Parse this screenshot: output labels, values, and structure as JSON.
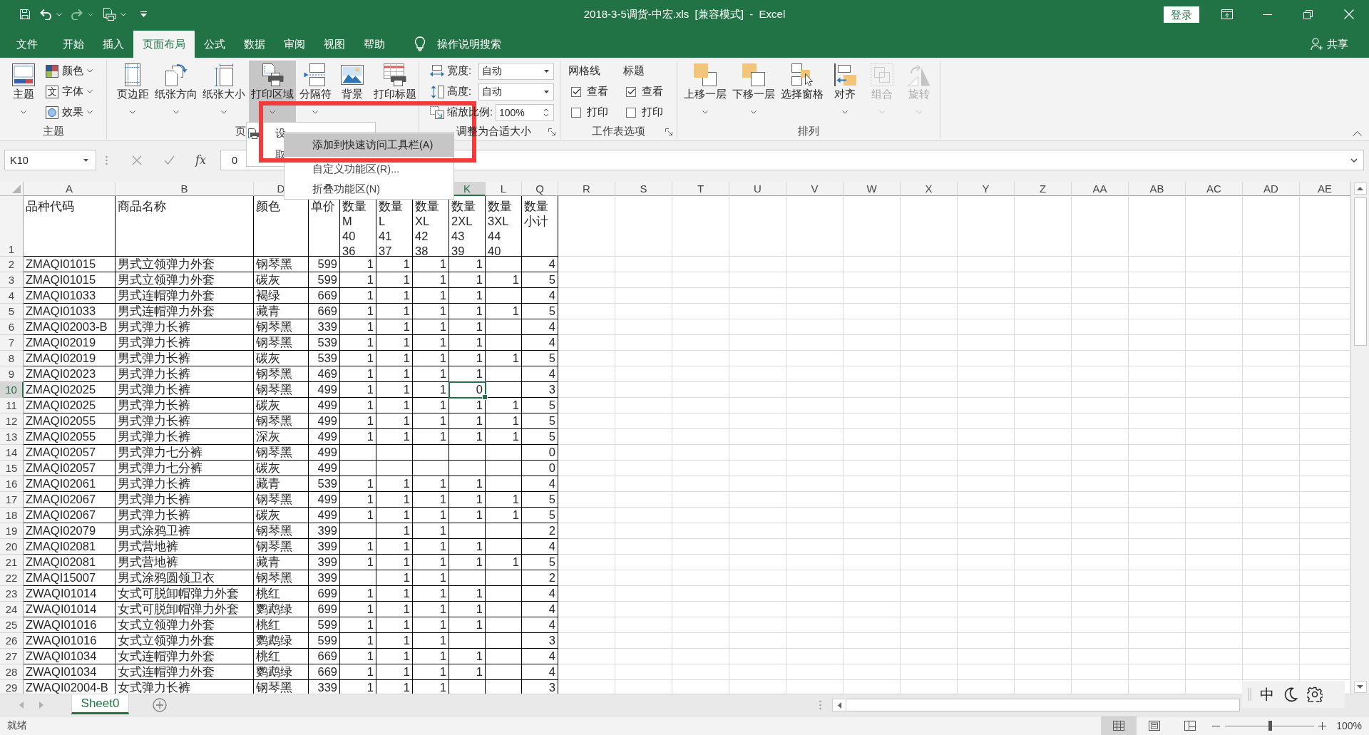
{
  "title_bar": {
    "quick_access": [
      {
        "kind": "save",
        "dropdown": false,
        "disabled": false
      },
      {
        "kind": "undo",
        "dropdown": true,
        "disabled": false
      },
      {
        "kind": "redo",
        "dropdown": true,
        "disabled": true
      },
      {
        "kind": "print_preview",
        "dropdown": true,
        "disabled": false
      }
    ],
    "title": "2018-3-5调货-中宏.xls  [兼容模式]  -  Excel",
    "sign_in": "登录"
  },
  "tabs": [
    {
      "label": "文件",
      "selected": false
    },
    {
      "label": "开始",
      "selected": false
    },
    {
      "label": "插入",
      "selected": false
    },
    {
      "label": "页面布局",
      "selected": true
    },
    {
      "label": "公式",
      "selected": false
    },
    {
      "label": "数据",
      "selected": false
    },
    {
      "label": "审阅",
      "selected": false
    },
    {
      "label": "视图",
      "selected": false
    },
    {
      "label": "帮助",
      "selected": false
    }
  ],
  "tell_me": "操作说明搜索",
  "share": "共享",
  "ribbon": {
    "groups": [
      {
        "kind": "theme",
        "label": "主题",
        "large": {
          "label": "主题",
          "dropdown": true
        },
        "small": [
          {
            "kind": "colors",
            "label": "颜色"
          },
          {
            "kind": "fonts",
            "label": "字体",
            "glyph": "文"
          },
          {
            "kind": "effects",
            "label": "效果"
          }
        ]
      },
      {
        "kind": "buttons",
        "label": "页",
        "buttons": [
          {
            "kind": "margins",
            "label": "页边距",
            "dropdown": true,
            "pressed": false
          },
          {
            "kind": "orientation",
            "label": "纸张方向",
            "dropdown": true,
            "pressed": false
          },
          {
            "kind": "size",
            "label": "纸张大小",
            "dropdown": true,
            "pressed": false
          },
          {
            "kind": "print_area",
            "label": "打印区域",
            "dropdown": true,
            "pressed": true
          },
          {
            "kind": "breaks",
            "label": "分隔符",
            "dropdown": true,
            "pressed": false
          },
          {
            "kind": "background",
            "label": "背景",
            "dropdown": false,
            "pressed": false
          },
          {
            "kind": "print_titles",
            "label": "打印标题",
            "dropdown": false,
            "pressed": false
          }
        ]
      },
      {
        "kind": "scale",
        "label": "调整为合适大小",
        "launcher": true,
        "rows": [
          {
            "kind": "combo",
            "label": "宽度:",
            "value": "自动"
          },
          {
            "kind": "combo",
            "label": "高度:",
            "value": "自动"
          },
          {
            "kind": "spin",
            "label": "缩放比例:",
            "value": "100%"
          }
        ]
      },
      {
        "kind": "sheet_options",
        "label": "工作表选项",
        "launcher": true,
        "columns": [
          {
            "heading": "网格线",
            "options": [
              {
                "label": "查看",
                "checked": true
              },
              {
                "label": "打印",
                "checked": false
              }
            ]
          },
          {
            "heading": "标题",
            "options": [
              {
                "label": "查看",
                "checked": true
              },
              {
                "label": "打印",
                "checked": false
              }
            ]
          }
        ]
      },
      {
        "kind": "buttons",
        "label": "排列",
        "launcher": false,
        "buttons": [
          {
            "kind": "bring_forward",
            "label": "上移一层",
            "dropdown": true,
            "disabled": false
          },
          {
            "kind": "send_backward",
            "label": "下移一层",
            "dropdown": true,
            "disabled": false
          },
          {
            "kind": "selection_pane",
            "label": "选择窗格",
            "dropdown": false,
            "disabled": false
          },
          {
            "kind": "align",
            "label": "对齐",
            "dropdown": true,
            "disabled": false
          },
          {
            "kind": "group",
            "label": "组合",
            "dropdown": true,
            "disabled": true
          },
          {
            "kind": "rotate",
            "label": "旋转",
            "dropdown": true,
            "disabled": true
          }
        ]
      }
    ]
  },
  "formula_bar": {
    "name_box": "K10",
    "function_label": "fx",
    "formula": "0"
  },
  "print_area_menu": {
    "items": [
      {
        "label": "设"
      },
      {
        "label": "取"
      }
    ]
  },
  "context_menu": {
    "items": [
      {
        "label": "添加到快速访问工具栏(A)",
        "selected": true
      },
      {
        "label": "自定义功能区(R)...",
        "selected": false
      },
      {
        "label": "折叠功能区(N)",
        "selected": false
      }
    ]
  },
  "annotation": {
    "kind": "frame"
  },
  "sheet": {
    "columns": [
      {
        "letter": "A",
        "selected": false
      },
      {
        "letter": "B",
        "selected": false
      },
      {
        "letter": "D",
        "selected": false
      },
      {},
      {},
      {},
      {},
      {
        "letter": "K",
        "selected": true
      },
      {
        "letter": "L",
        "selected": false
      },
      {
        "letter": "Q",
        "selected": false
      },
      {
        "letter": "R",
        "selected": false
      },
      {
        "letter": "S",
        "selected": false
      },
      {
        "letter": "T",
        "selected": false
      },
      {
        "letter": "U",
        "selected": false
      },
      {
        "letter": "V",
        "selected": false
      },
      {
        "letter": "W",
        "selected": false
      },
      {
        "letter": "X",
        "selected": false
      },
      {
        "letter": "Y",
        "selected": false
      },
      {
        "letter": "Z",
        "selected": false
      },
      {
        "letter": "AA",
        "selected": false
      },
      {
        "letter": "AB",
        "selected": false
      },
      {
        "letter": "AC",
        "selected": false
      },
      {
        "letter": "AD",
        "selected": false
      },
      {
        "letter": "AE",
        "selected": false
      }
    ],
    "rows": [
      {
        "number": "1",
        "kind": "header",
        "selected": false,
        "cells": [
          "品种代码",
          "商品名称",
          "颜色",
          "单价",
          "数量\nM\n40\n36",
          "数量\nL\n41\n37",
          "数量\nXL\n42\n38",
          "数量\n2XL\n43\n39",
          "数量\n3XL\n44\n40",
          "数量小计"
        ]
      },
      {
        "number": "2",
        "kind": "data",
        "selected": false,
        "cells": [
          "ZMAQI01015",
          "男式立领弹力外套",
          "钢琴黑",
          "599",
          "1",
          "1",
          "1",
          "1",
          null,
          "4"
        ]
      },
      {
        "number": "3",
        "kind": "data",
        "selected": false,
        "cells": [
          "ZMAQI01015",
          "男式立领弹力外套",
          "碳灰",
          "599",
          "1",
          "1",
          "1",
          "1",
          "1",
          "5"
        ]
      },
      {
        "number": "4",
        "kind": "data",
        "selected": false,
        "cells": [
          "ZMAQI01033",
          "男式连帽弹力外套",
          "褐绿",
          "669",
          "1",
          "1",
          "1",
          "1",
          null,
          "4"
        ]
      },
      {
        "number": "5",
        "kind": "data",
        "selected": false,
        "cells": [
          "ZMAQI01033",
          "男式连帽弹力外套",
          "藏青",
          "669",
          "1",
          "1",
          "1",
          "1",
          "1",
          "5"
        ]
      },
      {
        "number": "6",
        "kind": "data",
        "selected": false,
        "cells": [
          "ZMAQI02003-B",
          "男式弹力长裤",
          "钢琴黑",
          "339",
          "1",
          "1",
          "1",
          "1",
          null,
          "4"
        ]
      },
      {
        "number": "7",
        "kind": "data",
        "selected": false,
        "cells": [
          "ZMAQI02019",
          "男式弹力长裤",
          "钢琴黑",
          "539",
          "1",
          "1",
          "1",
          "1",
          null,
          "4"
        ]
      },
      {
        "number": "8",
        "kind": "data",
        "selected": false,
        "cells": [
          "ZMAQI02019",
          "男式弹力长裤",
          "碳灰",
          "539",
          "1",
          "1",
          "1",
          "1",
          "1",
          "5"
        ]
      },
      {
        "number": "9",
        "kind": "data",
        "selected": false,
        "cells": [
          "ZMAQI02023",
          "男式弹力长裤",
          "钢琴黑",
          "469",
          "1",
          "1",
          "1",
          "1",
          null,
          "4"
        ]
      },
      {
        "number": "10",
        "kind": "data",
        "selected": true,
        "cells": [
          "ZMAQI02025",
          "男式弹力长裤",
          "钢琴黑",
          "499",
          "1",
          "1",
          "1",
          "0",
          null,
          "3"
        ]
      },
      {
        "number": "11",
        "kind": "data",
        "selected": false,
        "cells": [
          "ZMAQI02025",
          "男式弹力长裤",
          "碳灰",
          "499",
          "1",
          "1",
          "1",
          "1",
          "1",
          "5"
        ]
      },
      {
        "number": "12",
        "kind": "data",
        "selected": false,
        "cells": [
          "ZMAQI02055",
          "男式弹力长裤",
          "钢琴黑",
          "499",
          "1",
          "1",
          "1",
          "1",
          "1",
          "5"
        ]
      },
      {
        "number": "13",
        "kind": "data",
        "selected": false,
        "cells": [
          "ZMAQI02055",
          "男式弹力长裤",
          "深灰",
          "499",
          "1",
          "1",
          "1",
          "1",
          "1",
          "5"
        ]
      },
      {
        "number": "14",
        "kind": "data",
        "selected": false,
        "cells": [
          "ZMAQI02057",
          "男式弹力七分裤",
          "钢琴黑",
          "499",
          null,
          null,
          null,
          null,
          null,
          "0"
        ]
      },
      {
        "number": "15",
        "kind": "data",
        "selected": false,
        "cells": [
          "ZMAQI02057",
          "男式弹力七分裤",
          "碳灰",
          "499",
          null,
          null,
          null,
          null,
          null,
          "0"
        ]
      },
      {
        "number": "16",
        "kind": "data",
        "selected": false,
        "cells": [
          "ZMAQI02061",
          "男式弹力长裤",
          "藏青",
          "539",
          "1",
          "1",
          "1",
          "1",
          null,
          "4"
        ]
      },
      {
        "number": "17",
        "kind": "data",
        "selected": false,
        "cells": [
          "ZMAQI02067",
          "男式弹力长裤",
          "钢琴黑",
          "499",
          "1",
          "1",
          "1",
          "1",
          "1",
          "5"
        ]
      },
      {
        "number": "18",
        "kind": "data",
        "selected": false,
        "cells": [
          "ZMAQI02067",
          "男式弹力长裤",
          "碳灰",
          "499",
          "1",
          "1",
          "1",
          "1",
          "1",
          "5"
        ]
      },
      {
        "number": "19",
        "kind": "data",
        "selected": false,
        "cells": [
          "ZMAQI02079",
          "男式涂鸦卫裤",
          "钢琴黑",
          "399",
          null,
          "1",
          "1",
          null,
          null,
          "2"
        ]
      },
      {
        "number": "20",
        "kind": "data",
        "selected": false,
        "cells": [
          "ZMAQI02081",
          "男式营地裤",
          "钢琴黑",
          "399",
          "1",
          "1",
          "1",
          "1",
          null,
          "4"
        ]
      },
      {
        "number": "21",
        "kind": "data",
        "selected": false,
        "cells": [
          "ZMAQI02081",
          "男式营地裤",
          "藏青",
          "399",
          "1",
          "1",
          "1",
          "1",
          "1",
          "5"
        ]
      },
      {
        "number": "22",
        "kind": "data",
        "selected": false,
        "cells": [
          "ZMAQI15007",
          "男式涂鸦圆领卫衣",
          "钢琴黑",
          "399",
          null,
          "1",
          "1",
          null,
          null,
          "2"
        ]
      },
      {
        "number": "23",
        "kind": "data",
        "selected": false,
        "cells": [
          "ZWAQI01014",
          "女式可脱卸帽弹力外套",
          "桃红",
          "699",
          "1",
          "1",
          "1",
          "1",
          null,
          "4"
        ]
      },
      {
        "number": "24",
        "kind": "data",
        "selected": false,
        "cells": [
          "ZWAQI01014",
          "女式可脱卸帽弹力外套",
          "鹦鹉绿",
          "699",
          "1",
          "1",
          "1",
          "1",
          null,
          "4"
        ]
      },
      {
        "number": "25",
        "kind": "data",
        "selected": false,
        "cells": [
          "ZWAQI01016",
          "女式立领弹力外套",
          "桃红",
          "599",
          "1",
          "1",
          "1",
          "1",
          null,
          "4"
        ]
      },
      {
        "number": "26",
        "kind": "data",
        "selected": false,
        "cells": [
          "ZWAQI01016",
          "女式立领弹力外套",
          "鹦鹉绿",
          "599",
          "1",
          "1",
          "1",
          null,
          null,
          "3"
        ]
      },
      {
        "number": "27",
        "kind": "data",
        "selected": false,
        "cells": [
          "ZWAQI01034",
          "女式连帽弹力外套",
          "桃红",
          "669",
          "1",
          "1",
          "1",
          "1",
          null,
          "4"
        ]
      },
      {
        "number": "28",
        "kind": "data",
        "selected": false,
        "cells": [
          "ZWAQI01034",
          "女式连帽弹力外套",
          "鹦鹉绿",
          "669",
          "1",
          "1",
          "1",
          "1",
          null,
          "4"
        ]
      },
      {
        "number": "29",
        "kind": "data",
        "selected": false,
        "cells": [
          "ZWAQI02004-B",
          "女式弹力长裤",
          "钢琴黑",
          "339",
          "1",
          "1",
          "1",
          null,
          null,
          "3"
        ]
      }
    ]
  },
  "sheet_tabs": [
    {
      "label": "Sheet0",
      "selected": true
    }
  ],
  "ime_toolbar": {
    "mode": "中"
  },
  "status_bar": {
    "status": "就绪",
    "views": [
      {
        "kind": "normal",
        "selected": true
      },
      {
        "kind": "page_layout",
        "selected": false
      },
      {
        "kind": "page_break",
        "selected": false
      }
    ],
    "zoom": {
      "level": 0.5,
      "reading": "100%"
    }
  }
}
